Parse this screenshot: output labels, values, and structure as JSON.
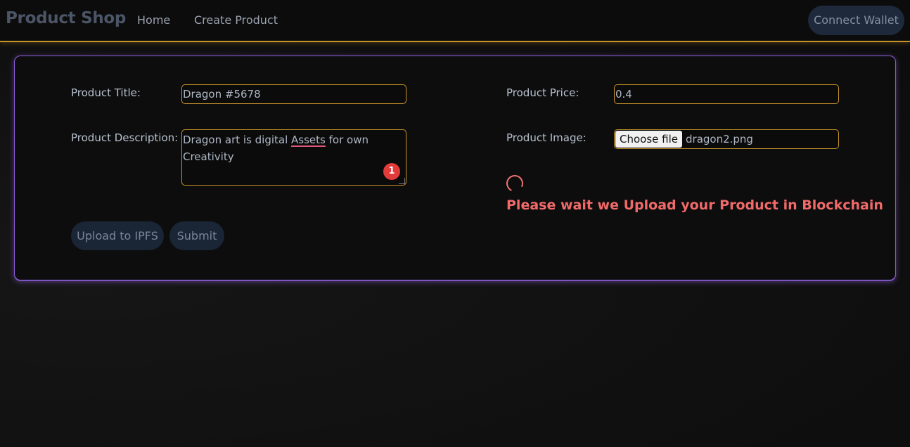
{
  "navbar": {
    "brand": "Product Shop",
    "links": [
      "Home",
      "Create Product"
    ],
    "wallet_button": "Connect Wallet"
  },
  "form": {
    "title_label": "Product Title:",
    "title_value": "Dragon #5678",
    "description_label": "Product Description:",
    "description_value_before": "Dragon art is digital ",
    "description_value_spell": "Assets",
    "description_value_after": " for own Creativity",
    "description_badge": "1",
    "price_label": "Product Price:",
    "price_value": "0.4",
    "image_label": "Product Image:",
    "file_button": "Choose file",
    "file_name": "dragon2.png",
    "status_message": "Please wait we Upload your Product in Blockchain",
    "upload_button": "Upload to IPFS",
    "submit_button": "Submit"
  },
  "colors": {
    "accent_border": "#c9952a",
    "card_border": "#8b5cd6",
    "status_text": "#f06a6a"
  }
}
